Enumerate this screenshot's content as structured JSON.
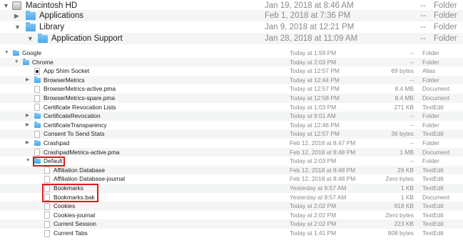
{
  "top_rows": [
    {
      "name": "Macintosh HD",
      "date": "Jan 19, 2018 at 8:46 AM",
      "size": "--",
      "kind": "Folder"
    },
    {
      "name": "Applications",
      "date": "Feb 1, 2018 at 7:36 PM",
      "size": "--",
      "kind": "Folder"
    },
    {
      "name": "Library",
      "date": "Jan 9, 2018 at 12:21 PM",
      "size": "--",
      "kind": "Folder"
    },
    {
      "name": "Application Support",
      "date": "Jan 28, 2018 at 11:09 AM",
      "size": "--",
      "kind": "Folder"
    }
  ],
  "rows": [
    {
      "name": "Google",
      "date": "Today at 1:59 PM",
      "size": "--",
      "kind": "Folder"
    },
    {
      "name": "Chrome",
      "date": "Today at 2:03 PM",
      "size": "--",
      "kind": "Folder"
    },
    {
      "name": "App Shim Socket",
      "date": "Today at 12:57 PM",
      "size": "69 bytes",
      "kind": "Alias"
    },
    {
      "name": "BrowserMetrics",
      "date": "Today at 12:44 PM",
      "size": "--",
      "kind": "Folder"
    },
    {
      "name": "BrowserMetrics-active.pma",
      "date": "Today at 12:57 PM",
      "size": "8.4 MB",
      "kind": "Document"
    },
    {
      "name": "BrowserMetrics-spare.pma",
      "date": "Today at 12:58 PM",
      "size": "8.4 MB",
      "kind": "Document"
    },
    {
      "name": "Certificate Revocation Lists",
      "date": "Today at 1:03 PM",
      "size": "271 KB",
      "kind": "TextEdit"
    },
    {
      "name": "CertificateRevocation",
      "date": "Today at 9:01 AM",
      "size": "--",
      "kind": "Folder"
    },
    {
      "name": "CertificateTransparency",
      "date": "Today at 12:46 PM",
      "size": "--",
      "kind": "Folder"
    },
    {
      "name": "Consent To Send Stats",
      "date": "Today at 12:57 PM",
      "size": "36 bytes",
      "kind": "TextEdit"
    },
    {
      "name": "Crashpad",
      "date": "Feb 12, 2018 at 8:47 PM",
      "size": "--",
      "kind": "Folder"
    },
    {
      "name": "CrashpadMetrics-active.pma",
      "date": "Feb 12, 2018 at 8:48 PM",
      "size": "1 MB",
      "kind": "Document"
    },
    {
      "name": "Default",
      "date": "Today at 2:03 PM",
      "size": "--",
      "kind": "Folder"
    },
    {
      "name": "Affiliation Database",
      "date": "Feb 12, 2018 at 8:48 PM",
      "size": "29 KB",
      "kind": "TextEdit"
    },
    {
      "name": "Affiliation Database-journal",
      "date": "Feb 12, 2018 at 8:48 PM",
      "size": "Zero bytes",
      "kind": "TextEdit"
    },
    {
      "name": "Bookmarks",
      "date": "Yesterday at 8:57 AM",
      "size": "1 KB",
      "kind": "TextEdit"
    },
    {
      "name": "Bookmarks.bak",
      "date": "Yesterday at 8:57 AM",
      "size": "1 KB",
      "kind": "Document"
    },
    {
      "name": "Cookies",
      "date": "Today at 2:02 PM",
      "size": "918 KB",
      "kind": "TextEdit"
    },
    {
      "name": "Cookies-journal",
      "date": "Today at 2:02 PM",
      "size": "Zero bytes",
      "kind": "TextEdit"
    },
    {
      "name": "Current Session",
      "date": "Today at 2:02 PM",
      "size": "223 KB",
      "kind": "TextEdit"
    },
    {
      "name": "Current Tabs",
      "date": "Today at 1:41 PM",
      "size": "808 bytes",
      "kind": "TextEdit"
    }
  ]
}
